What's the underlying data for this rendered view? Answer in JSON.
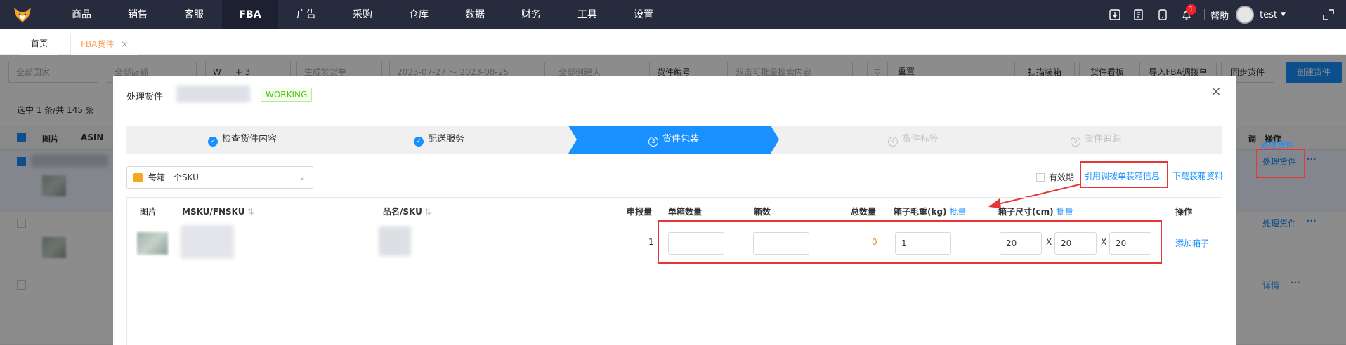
{
  "nav": {
    "items": [
      "商品",
      "销售",
      "客服",
      "FBA",
      "广告",
      "采购",
      "仓库",
      "数据",
      "财务",
      "工具",
      "设置"
    ],
    "active": "FBA",
    "help": "帮助",
    "user": "test",
    "notification_count": "1"
  },
  "tabs": {
    "home": "首页",
    "fba": "FBA货件",
    "close": "×"
  },
  "background": {
    "filters": {
      "country": "全部国家",
      "shop": "全部店铺",
      "tag_w": "W",
      "tag_more": "+ 3",
      "ship_status": "生成发货单",
      "date_range": "2023-07-27 ～ 2023-08-25",
      "creator": "全部创建人",
      "field": "货件编号",
      "search_placeholder": "双击可批量搜索内容",
      "reset": "重置"
    },
    "buttons": {
      "scan": "扫描装箱",
      "board": "货件看板",
      "import": "导入FBA调拨单",
      "sync": "同步货件",
      "create": "创建货件"
    },
    "selection_info": "选中 1 条/共 145 条",
    "columns": {
      "image": "图片",
      "asin": "ASIN",
      "adjust": "调",
      "action": "操作"
    },
    "row_actions": [
      "处理货件",
      "处理货件",
      "详情"
    ],
    "dash": "-",
    "more": "···"
  },
  "modal": {
    "title": "处理货件",
    "status_badge": "WORKING",
    "close": "×",
    "steps": [
      {
        "label": "检查货件内容",
        "state": "done",
        "mark": "✓"
      },
      {
        "label": "配送服务",
        "state": "done",
        "mark": "✓"
      },
      {
        "label": "货件包装",
        "state": "current",
        "mark": "3"
      },
      {
        "label": "货件标签",
        "state": "todo",
        "mark": "4"
      },
      {
        "label": "货件追踪",
        "state": "todo",
        "mark": "5"
      }
    ],
    "pack_mode": "每箱一个SKU",
    "validity_label": "有效期",
    "ref_link": "引用调拨单装箱信息",
    "download_link": "下载装箱资料",
    "table": {
      "headers": {
        "image": "图片",
        "msku": "MSKU/FNSKU",
        "name": "品名/SKU",
        "declared": "申报量",
        "per_box": "单箱数量",
        "boxes": "箱数",
        "total": "总数量",
        "weight": "箱子毛重(kg)",
        "weight_batch": "批量",
        "size": "箱子尺寸(cm)",
        "size_batch": "批量",
        "action": "操作"
      },
      "rows": [
        {
          "declared": "1",
          "per_box": "",
          "boxes": "",
          "total": "0",
          "weight": "1",
          "length": "20",
          "width": "20",
          "height": "20",
          "x": "X",
          "action": "添加箱子"
        }
      ]
    }
  },
  "colors": {
    "nav_bg": "#262b3d",
    "primary": "#1890ff",
    "highlight": "#e63636",
    "working": "#52c41a",
    "total": "#fa8c16"
  }
}
